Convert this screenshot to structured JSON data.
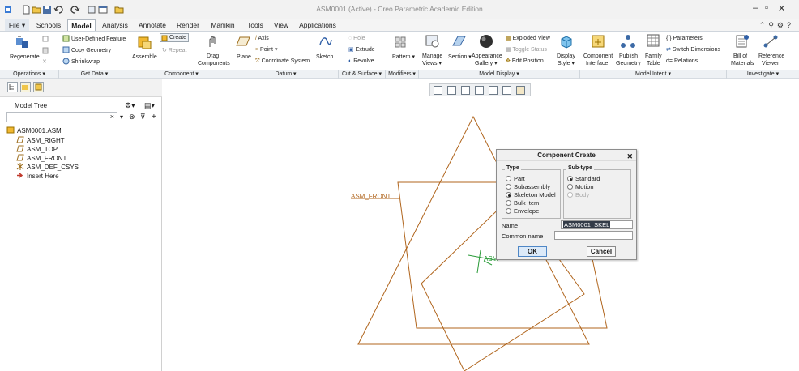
{
  "window": {
    "title": "ASM0001 (Active) - Creo Parametric Academic Edition"
  },
  "tabs": [
    "File",
    "Schools",
    "Model",
    "Analysis",
    "Annotate",
    "Render",
    "Manikin",
    "Tools",
    "View",
    "Applications"
  ],
  "ribbon": {
    "operations": {
      "regenerate": "Regenerate",
      "udf": "User-Defined Feature",
      "copy_geometry": "Copy Geometry",
      "shrinkwrap": "Shrinkwrap"
    },
    "component": {
      "assemble": "Assemble",
      "create": "Create",
      "repeat": "Repeat",
      "drag": "Drag",
      "components": "Components"
    },
    "datum": {
      "plane": "Plane",
      "axis": "Axis",
      "point": "Point",
      "csys": "Coordinate System",
      "sketch": "Sketch"
    },
    "cut_surface": {
      "hole": "Hole",
      "extrude": "Extrude",
      "revolve": "Revolve"
    },
    "modifiers": {
      "pattern": "Pattern"
    },
    "model_display": {
      "manage": "Manage",
      "views": "Views",
      "section": "Section",
      "appearance": "Appearance",
      "gallery": "Gallery",
      "exploded_view": "Exploded View",
      "toggle_status": "Toggle Status",
      "edit_position": "Edit Position",
      "display": "Display",
      "style": "Style"
    },
    "model_intent": {
      "component": "Component",
      "interface": "Interface",
      "publish": "Publish",
      "geometry": "Geometry",
      "family": "Family",
      "table": "Table",
      "parameters": "Parameters",
      "switch_dimensions": "Switch Dimensions",
      "relations": "Relations"
    },
    "investigate": {
      "bill_of": "Bill of",
      "materials": "Materials",
      "reference": "Reference",
      "viewer": "Viewer"
    }
  },
  "groups": [
    "Operations",
    "Get Data",
    "Component",
    "Datum",
    "Cut & Surface",
    "Modifiers",
    "Model Display",
    "Model Intent",
    "Investigate"
  ],
  "model_tree": {
    "title": "Model Tree",
    "items": [
      "ASM0001.ASM",
      "ASM_RIGHT",
      "ASM_TOP",
      "ASM_FRONT",
      "ASM_DEF_CSYS",
      "Insert Here"
    ]
  },
  "canvas": {
    "datum_label": "ASM_FRONT",
    "csys_label": "ASM"
  },
  "dialog": {
    "title": "Component Create",
    "type_label": "Type",
    "types": [
      "Part",
      "Subassembly",
      "Skeleton Model",
      "Bulk Item",
      "Envelope"
    ],
    "type_selected": "Skeleton Model",
    "subtype_label": "Sub-type",
    "subtypes": [
      "Standard",
      "Motion",
      "Body"
    ],
    "subtype_selected": "Standard",
    "name_label": "Name",
    "name_value": "ASM0001_SKEL",
    "common_name_label": "Common name",
    "common_name_value": "",
    "ok": "OK",
    "cancel": "Cancel"
  }
}
